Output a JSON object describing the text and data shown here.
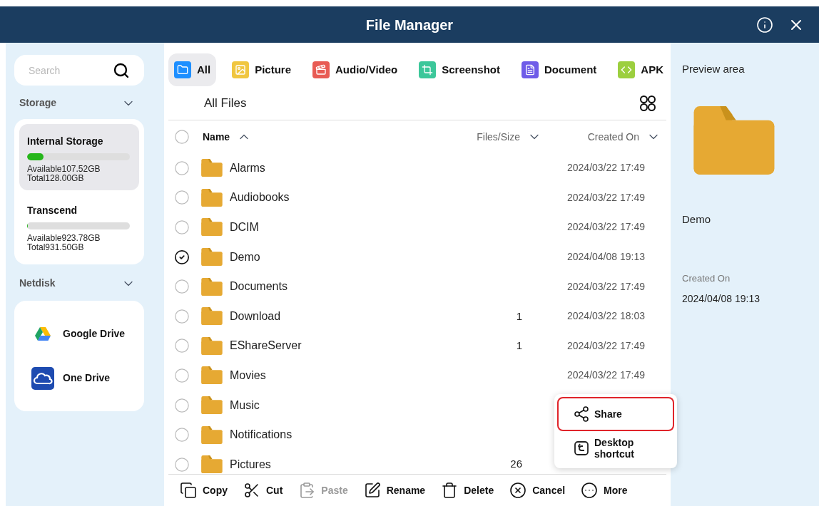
{
  "window": {
    "title": "File Manager"
  },
  "sidebar": {
    "search": {
      "placeholder": "Search"
    },
    "storage_label": "Storage",
    "storage": [
      {
        "name": "Internal Storage",
        "selected": true,
        "level": 0.16,
        "available": "Available107.52GB",
        "total": "Total128.00GB"
      },
      {
        "name": "Transcend",
        "selected": false,
        "level": 0.01,
        "available": "Available923.78GB",
        "total": "Total931.50GB"
      }
    ],
    "netdisk_label": "Netdisk",
    "netdisks": [
      {
        "kind": "google",
        "name": "Google Drive"
      },
      {
        "kind": "onedrive",
        "name": "One Drive"
      }
    ]
  },
  "tabs": [
    {
      "kind": "all",
      "label": "All",
      "selected": true,
      "color": "#1e8fff"
    },
    {
      "kind": "picture",
      "label": "Picture",
      "selected": false,
      "color": "#f0c640"
    },
    {
      "kind": "media",
      "label": "Audio/Video",
      "selected": false,
      "color": "#e85b54"
    },
    {
      "kind": "screenshot",
      "label": "Screenshot",
      "selected": false,
      "color": "#3cc79a"
    },
    {
      "kind": "document",
      "label": "Document",
      "selected": false,
      "color": "#6f5ce8"
    },
    {
      "kind": "apk",
      "label": "APK",
      "selected": false,
      "color": "#9ccf3f"
    }
  ],
  "breadcrumb": "All Files",
  "table": {
    "select_all": false,
    "columns": [
      {
        "label": "Name",
        "ascending": true
      },
      {
        "label": "Files/Size",
        "ascending": false
      },
      {
        "label": "Created On",
        "ascending": false
      }
    ],
    "rows": [
      {
        "name": "Alarms",
        "count": "",
        "created": "2024/03/22 17:49",
        "checked": false
      },
      {
        "name": "Audiobooks",
        "count": "",
        "created": "2024/03/22 17:49",
        "checked": false
      },
      {
        "name": "DCIM",
        "count": "",
        "created": "2024/03/22 17:49",
        "checked": false
      },
      {
        "name": "Demo",
        "count": "",
        "created": "2024/04/08 19:13",
        "checked": true
      },
      {
        "name": "Documents",
        "count": "",
        "created": "2024/03/22 17:49",
        "checked": false
      },
      {
        "name": "Download",
        "count": "1",
        "created": "2024/03/22 18:03",
        "checked": false
      },
      {
        "name": "EShareServer",
        "count": "1",
        "created": "2024/03/22 17:49",
        "checked": false
      },
      {
        "name": "Movies",
        "count": "",
        "created": "2024/03/22 17:49",
        "checked": false
      },
      {
        "name": "Music",
        "count": "",
        "created": "",
        "checked": false
      },
      {
        "name": "Notifications",
        "count": "",
        "created": "",
        "checked": false
      },
      {
        "name": "Pictures",
        "count": "26",
        "created": "",
        "checked": false
      }
    ]
  },
  "context_menu": [
    {
      "kind": "share",
      "label": "Share",
      "selected": true
    },
    {
      "kind": "shortcut",
      "label": "Desktop shortcut",
      "selected": false
    }
  ],
  "toolbar": [
    {
      "kind": "copy",
      "label": "Copy",
      "disabled": false
    },
    {
      "kind": "cut",
      "label": "Cut",
      "disabled": false
    },
    {
      "kind": "paste",
      "label": "Paste",
      "disabled": true
    },
    {
      "kind": "rename",
      "label": "Rename",
      "disabled": false
    },
    {
      "kind": "delete",
      "label": "Delete",
      "disabled": false
    },
    {
      "kind": "cancel",
      "label": "Cancel",
      "disabled": false
    },
    {
      "kind": "more",
      "label": "More",
      "disabled": false
    }
  ],
  "preview": {
    "title": "Preview area",
    "name": "Demo",
    "created_label": "Created On",
    "created": "2024/04/08 19:13"
  }
}
